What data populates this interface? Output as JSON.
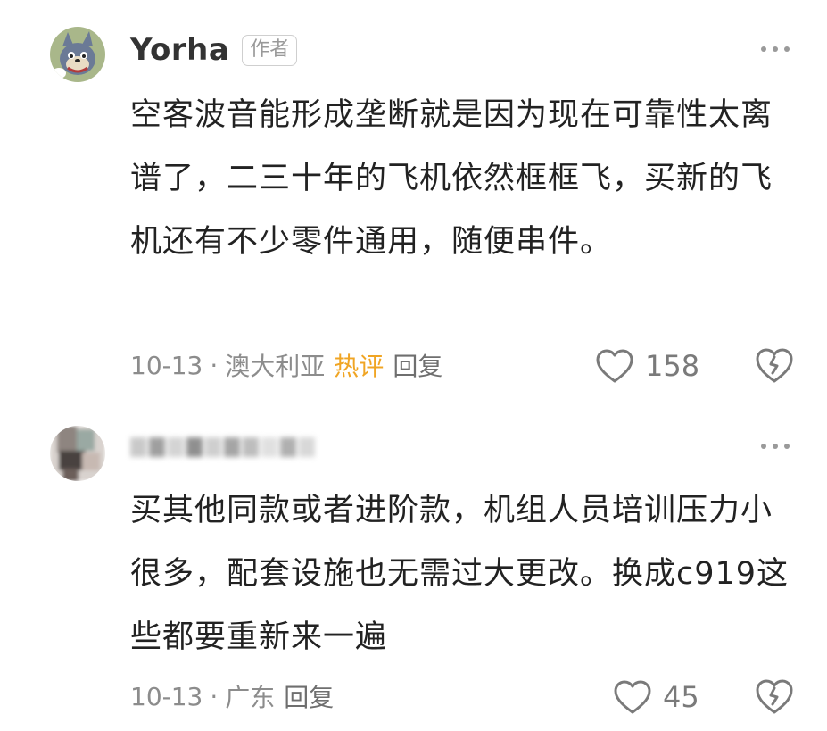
{
  "comments": [
    {
      "author": "Yorha",
      "author_badge": "作者",
      "text": "空客波音能形成垄断就是因为现在可靠性太离谱了，二三十年的飞机依然框框飞，买新的飞机还有不少零件通用，随便串件。",
      "date": "10-13",
      "location": "澳大利亚",
      "hot_label": "热评",
      "reply_label": "回复",
      "likes": "158",
      "avatar_icon": "cartoon-cat-avatar"
    },
    {
      "author": "",
      "text": "买其他同款或者进阶款，机组人员培训压力小很多，配套设施也无需过大更改。换成c919这些都要重新来一遍",
      "date": "10-13",
      "location": "广东",
      "reply_label": "回复",
      "likes": "45",
      "avatar_icon": "blurred-avatar"
    }
  ],
  "meta_separator": "·",
  "colors": {
    "hot_label": "#f0a524",
    "meta_text": "#8c8c8c",
    "body_text": "#222222"
  }
}
